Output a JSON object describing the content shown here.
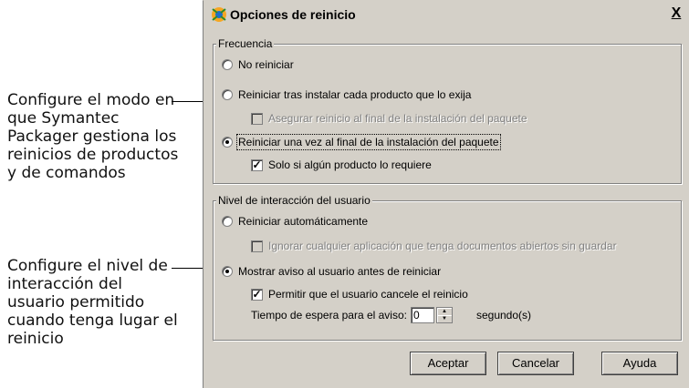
{
  "callouts": {
    "top": "Configure el modo en que Symantec Packager gestiona los reinicios de productos y de comandos",
    "bottom": "Configure el nivel de interacción del usuario permitido cuando tenga lugar el reinicio"
  },
  "dialog": {
    "title": "Opciones de reinicio",
    "close_label": "X",
    "frecuencia": {
      "label": "Frecuencia",
      "options": {
        "no_reiniciar": "No reiniciar",
        "reiniciar_tras": "Reiniciar tras instalar cada producto que lo exija",
        "asegurar": "Asegurar reinicio al final de la instalación del paquete",
        "reiniciar_una_vez": "Reiniciar una vez al final de la instalación del paquete",
        "solo_si": "Solo si algún producto lo requiere"
      }
    },
    "nivel": {
      "label": "Nivel de interacción del usuario",
      "options": {
        "reiniciar_auto": "Reiniciar automáticamente",
        "ignorar": "Ignorar cualquier aplicación que tenga documentos abiertos sin guardar",
        "mostrar_aviso": "Mostrar aviso al usuario antes de reiniciar",
        "permitir": "Permitir que el usuario cancele el reinicio"
      },
      "timeout_label": "Tiempo de espera para el aviso:",
      "timeout_value": "0",
      "timeout_unit": "segundo(s)"
    },
    "buttons": {
      "ok": "Aceptar",
      "cancel": "Cancelar",
      "help": "Ayuda"
    }
  }
}
